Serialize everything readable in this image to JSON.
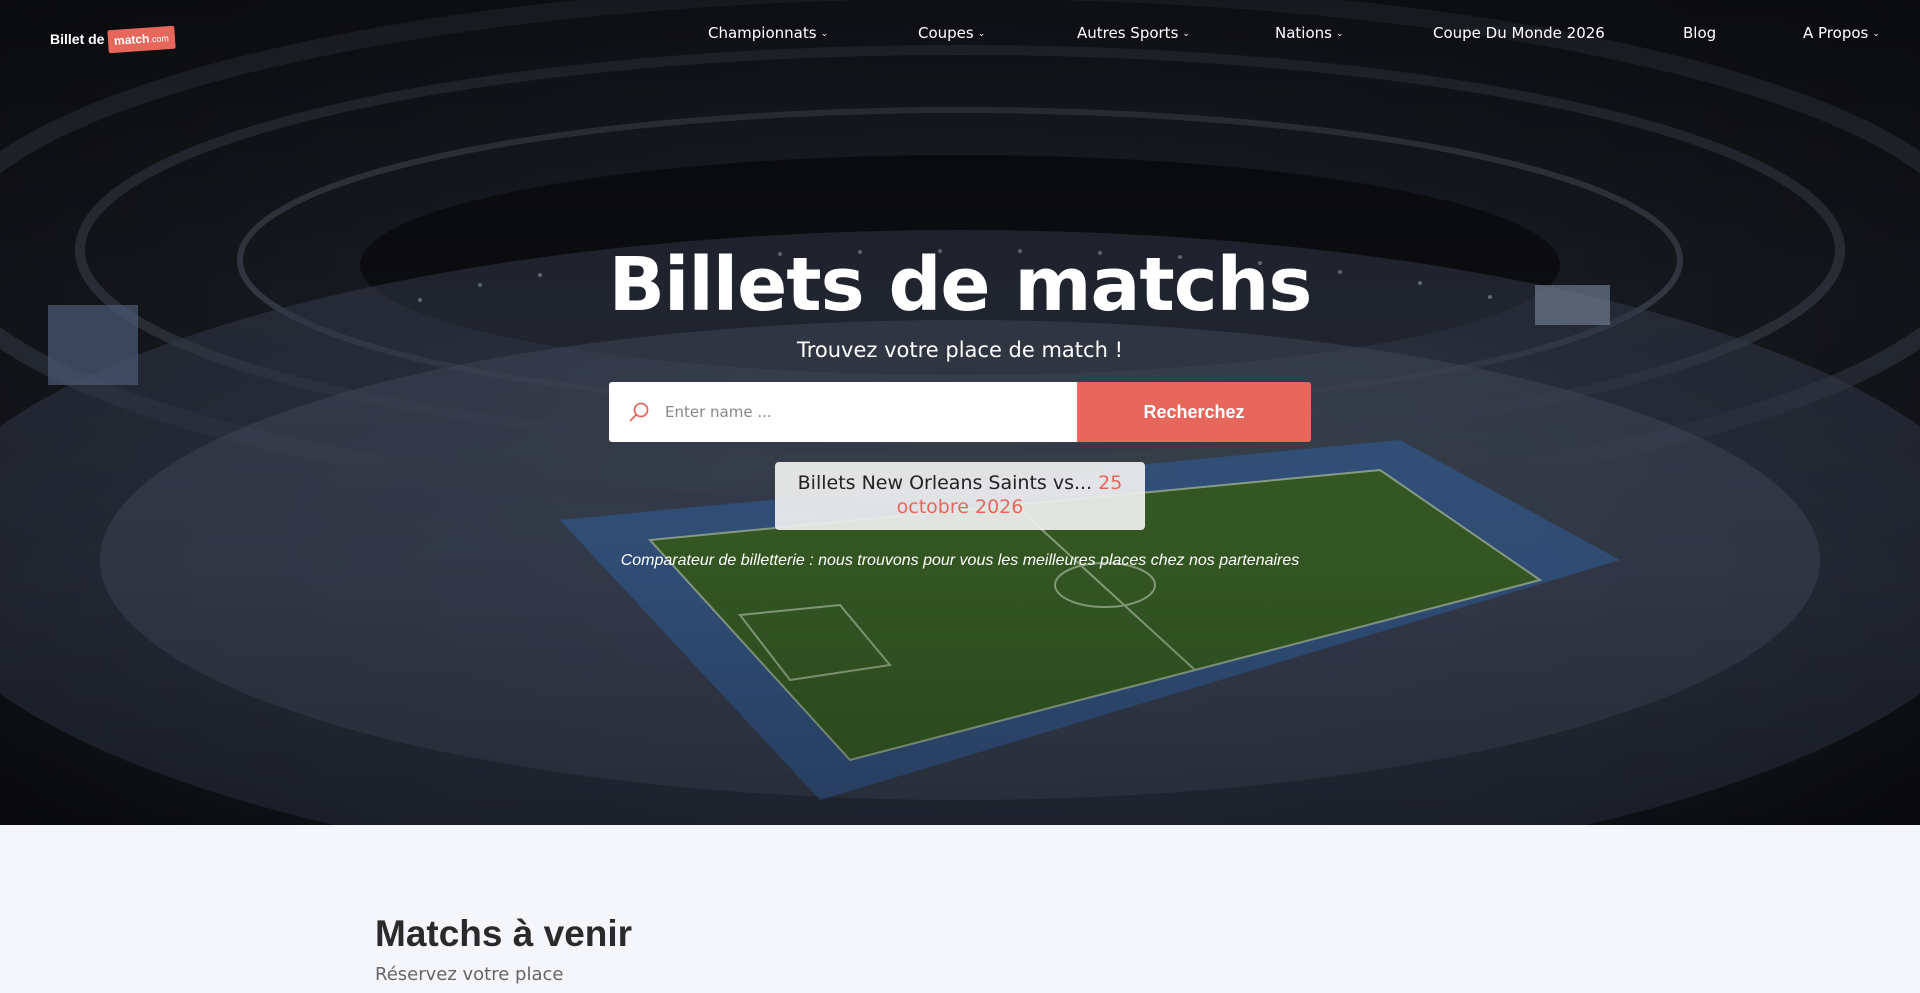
{
  "brand": {
    "logo_text_left": "Billet de",
    "logo_text_tag": "match",
    "logo_text_suffix": ".com"
  },
  "nav": {
    "items": [
      {
        "label": "Championnats",
        "has_dropdown": true
      },
      {
        "label": "Coupes",
        "has_dropdown": true
      },
      {
        "label": "Autres Sports",
        "has_dropdown": true
      },
      {
        "label": "Nations",
        "has_dropdown": true
      },
      {
        "label": "Coupe Du Monde 2026",
        "has_dropdown": false
      },
      {
        "label": "Blog",
        "has_dropdown": false
      },
      {
        "label": "A Propos",
        "has_dropdown": true
      }
    ],
    "chevron_glyph": "⌄"
  },
  "hero": {
    "title": "Billets de matchs",
    "subtitle": "Trouvez votre place de match !",
    "search": {
      "placeholder": "Enter name ...",
      "value": "",
      "icon": "search-icon",
      "button_label": "Recherchez"
    },
    "suggestion": {
      "title": "Billets New Orleans Saints vs...",
      "date": "25 octobre 2026"
    },
    "tagline": "Comparateur de billetterie : nous trouvons pour vous les meilleures places chez nos partenaires"
  },
  "upcoming": {
    "title": "Matchs à venir",
    "subtitle": "Réservez votre place"
  },
  "colors": {
    "accent": "#e8675c",
    "page_background": "#f5f5fc",
    "hero_text": "#ffffff"
  }
}
